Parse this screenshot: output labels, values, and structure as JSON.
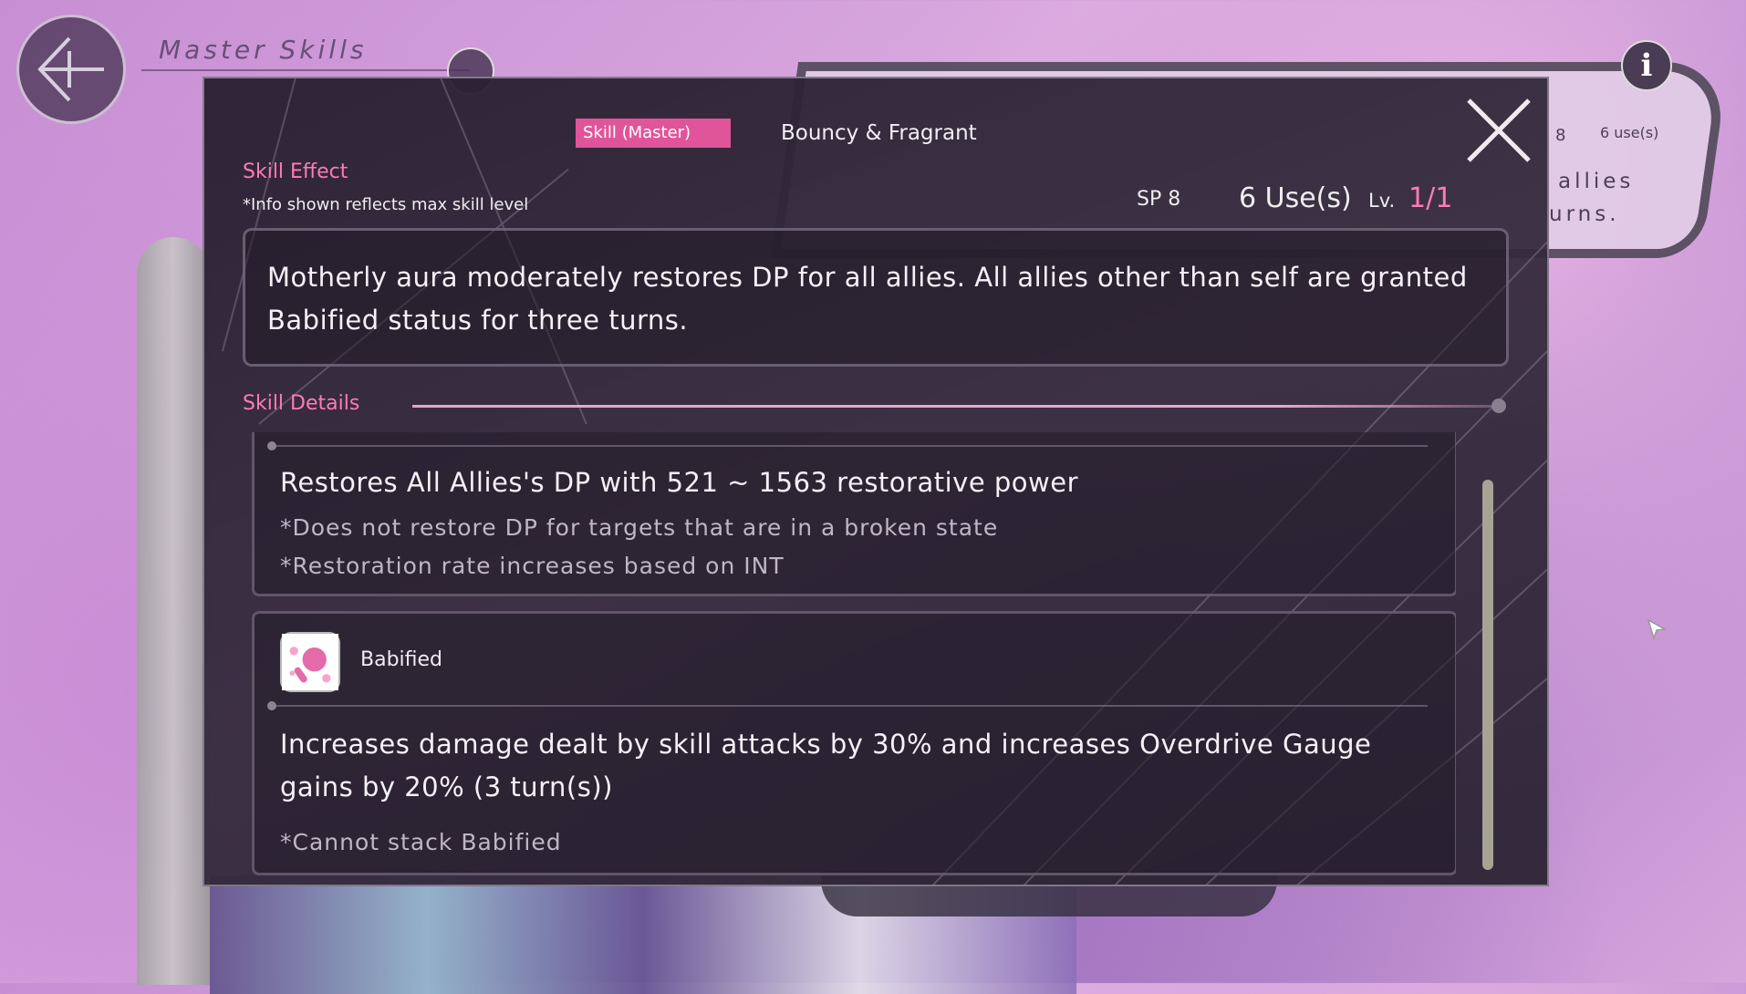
{
  "header": {
    "title": "Master Skills"
  },
  "background_card": {
    "sp_fragment": "8",
    "uses": "6 use(s)",
    "text_line1": "allies",
    "text_line2": "urns."
  },
  "dialog": {
    "tag": "Skill (Master)",
    "skill_name": "Bouncy & Fragrant",
    "skill_effect_label": "Skill Effect",
    "note": "*Info shown reflects max skill level",
    "sp": "SP 8",
    "uses": "6 Use(s)",
    "level_label": "Lv.",
    "level_value": "1/1",
    "effect_text": "Motherly aura moderately restores DP for all allies. All allies other than self are granted Babified status for three turns.",
    "skill_details_label": "Skill Details",
    "details": [
      {
        "main": "Restores All Allies's DP with 521 ~ 1563 restorative power",
        "notes": [
          "*Does not restore DP for targets that are in a broken state",
          "*Restoration rate increases based on INT"
        ]
      }
    ],
    "status": {
      "name": "Babified",
      "icon": "baby-rattle-icon",
      "description": "Increases damage dealt by skill attacks by 30% and increases Overdrive Gauge gains by 20% (3 turn(s))",
      "note": "*Cannot stack Babified"
    }
  },
  "colors": {
    "accent_pink": "#ff7ab8",
    "tag_pink": "#e0549a"
  }
}
